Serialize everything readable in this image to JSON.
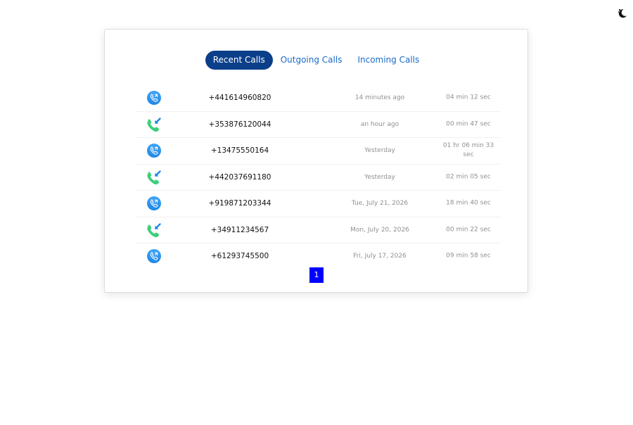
{
  "theme_toggle": {
    "icon": "moon-icon"
  },
  "tabs": [
    {
      "label": "Recent Calls",
      "active": true
    },
    {
      "label": "Outgoing Calls",
      "active": false
    },
    {
      "label": "Incoming Calls",
      "active": false
    }
  ],
  "calls": [
    {
      "direction": "outgoing",
      "icon": "outgoing-call-icon",
      "number": "+441614960820",
      "time": "14 minutes ago",
      "duration": "04 min 12 sec"
    },
    {
      "direction": "incoming",
      "icon": "incoming-call-icon",
      "number": "+353876120044",
      "time": "an hour ago",
      "duration": "00 min 47 sec"
    },
    {
      "direction": "outgoing",
      "icon": "outgoing-call-icon",
      "number": "+13475550164",
      "time": "Yesterday",
      "duration": "01 hr 06 min 33 sec"
    },
    {
      "direction": "incoming",
      "icon": "incoming-call-icon",
      "number": "+442037691180",
      "time": "Yesterday",
      "duration": "02 min 05 sec"
    },
    {
      "direction": "outgoing",
      "icon": "outgoing-call-icon",
      "number": "+919871203344",
      "time": "Tue, July 21, 2026",
      "duration": "18 min 40 sec"
    },
    {
      "direction": "incoming",
      "icon": "incoming-call-icon",
      "number": "+34911234567",
      "time": "Mon, July 20, 2026",
      "duration": "00 min 22 sec"
    },
    {
      "direction": "outgoing",
      "icon": "outgoing-call-icon",
      "number": "+61293745500",
      "time": "Fri, July 17, 2026",
      "duration": "09 min 58 sec"
    }
  ],
  "pagination": {
    "current_page": "1"
  },
  "colors": {
    "active_tab": "#0c3f8a",
    "tab_text": "#1a6ac8",
    "outgoing_icon": "#1e88e5",
    "incoming_phone": "#3ccf7a",
    "incoming_arrow": "#1e88e5",
    "pager": "#0000ff"
  }
}
